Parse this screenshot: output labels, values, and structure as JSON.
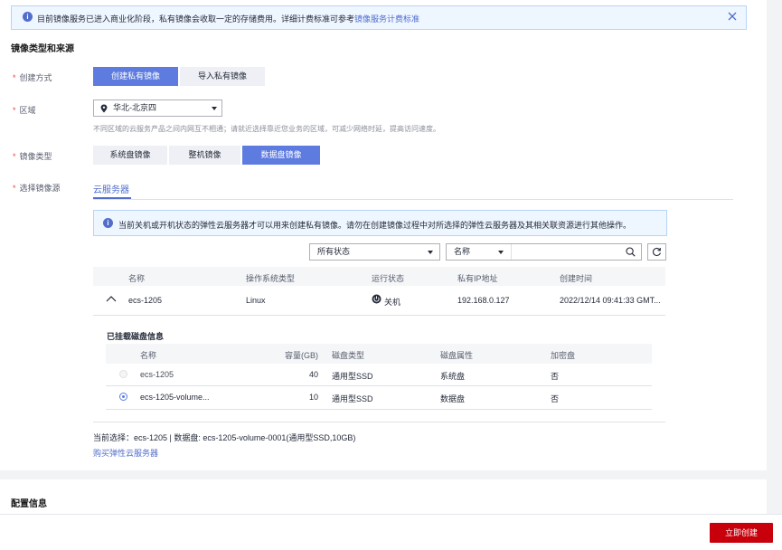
{
  "notice": {
    "text": "目前镜像服务已进入商业化阶段，私有镜像会收取一定的存储费用。详细计费标准可参考",
    "link": "镜像服务计费标准"
  },
  "section_source": {
    "title": "镜像类型和来源",
    "create_method": {
      "label": "创建方式",
      "options": [
        "创建私有镜像",
        "导入私有镜像"
      ],
      "selected": "创建私有镜像"
    },
    "region": {
      "label": "区域",
      "value": "华北-北京四",
      "tip": "不同区域的云服务产品之间内网互不相通；请就近选择靠近您业务的区域，可减少网络时延，提高访问速度。"
    },
    "image_type": {
      "label": "镜像类型",
      "options": [
        "系统盘镜像",
        "整机镜像",
        "数据盘镜像"
      ],
      "selected": "数据盘镜像"
    },
    "image_source": {
      "label": "选择镜像源",
      "tab": "云服务器",
      "info": "当前关机或开机状态的弹性云服务器才可以用来创建私有镜像。请勿在创建镜像过程中对所选择的弹性云服务器及其相关联资源进行其他操作。",
      "status_filter": "所有状态",
      "search_field": "名称",
      "search_value": ""
    }
  },
  "server_table": {
    "headers": [
      "名称",
      "操作系统类型",
      "运行状态",
      "私有IP地址",
      "创建时间"
    ],
    "rows": [
      {
        "name": "ecs-1205",
        "os": "Linux",
        "status": "关机",
        "ip": "192.168.0.127",
        "created": "2022/12/14 09:41:33 GMT..."
      }
    ]
  },
  "disk_info": {
    "title": "已挂载磁盘信息",
    "headers": [
      "名称",
      "容量(GB)",
      "磁盘类型",
      "磁盘属性",
      "加密盘"
    ],
    "rows": [
      {
        "name": "ecs-1205",
        "capacity": "40",
        "type": "通用型SSD",
        "attr": "系统盘",
        "encrypted": "否",
        "selected": false,
        "disabled": true
      },
      {
        "name": "ecs-1205-volume...",
        "capacity": "10",
        "type": "通用型SSD",
        "attr": "数据盘",
        "encrypted": "否",
        "selected": true,
        "disabled": false
      }
    ]
  },
  "selection_summary": "当前选择：ecs-1205 | 数据盘: ecs-1205-volume-0001(通用型SSD,10GB)",
  "buy_link": "购买弹性云服务器",
  "section_config": {
    "title": "配置信息"
  },
  "footer": {
    "create_button": "立即创建"
  },
  "colors": {
    "primary": "#5e7ce0",
    "danger": "#c7000b",
    "link": "#526ecc"
  }
}
